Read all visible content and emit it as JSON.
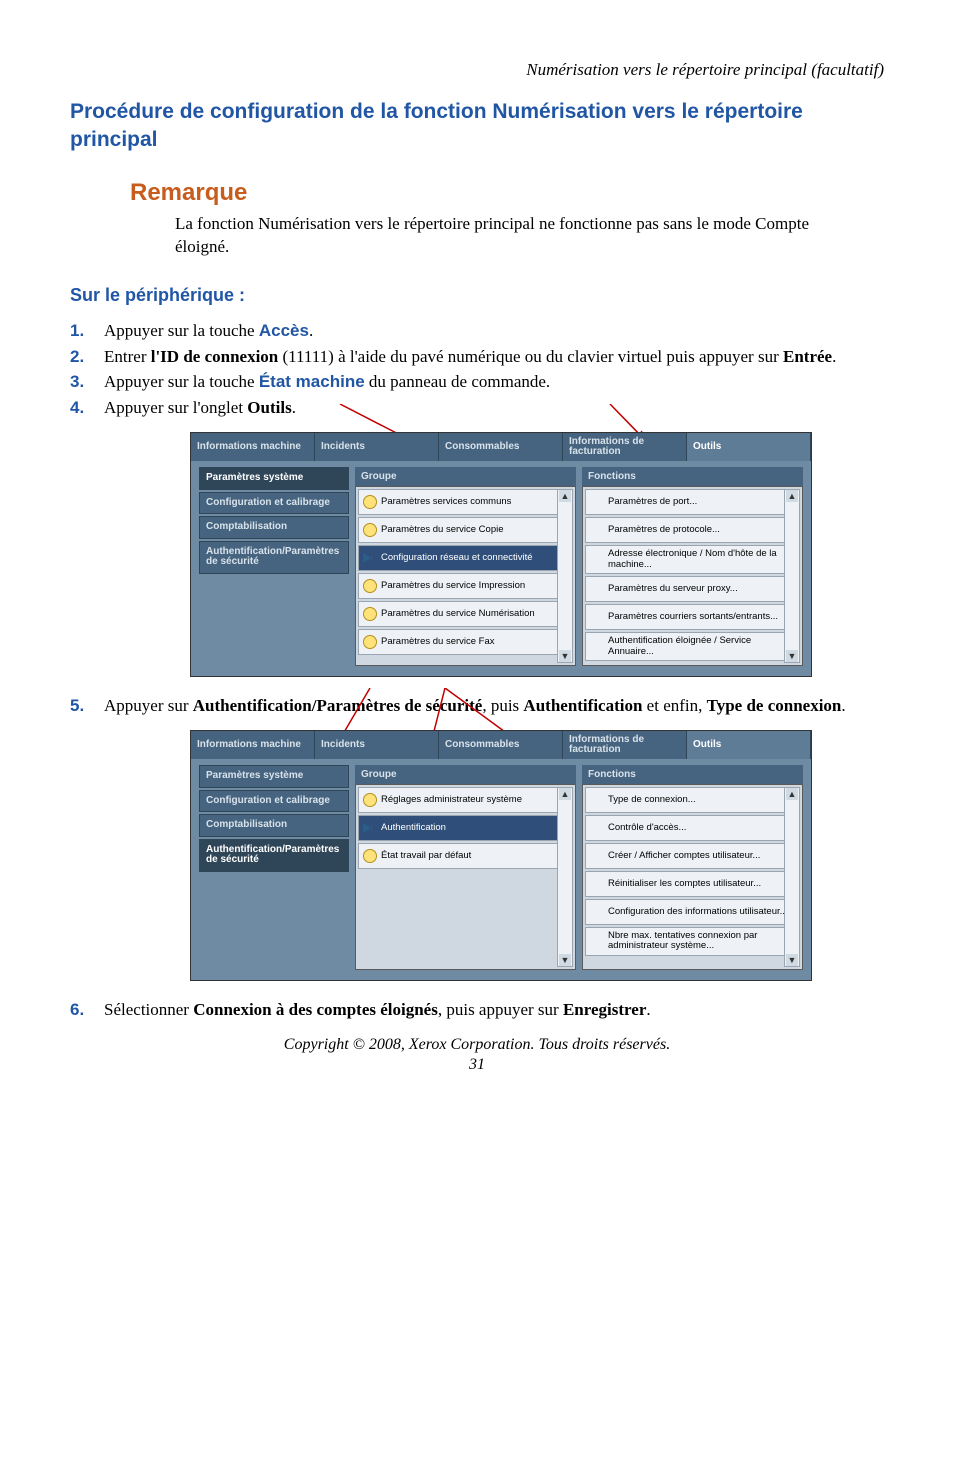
{
  "running_header": "Numérisation vers le répertoire principal (facultatif)",
  "title": "Procédure de configuration de la fonction Numérisation vers le répertoire principal",
  "remarque_heading": "Remarque",
  "remarque_body": "La fonction Numérisation vers le répertoire principal ne fonctionne pas sans le mode Compte éloigné.",
  "subhead": "Sur le périphérique :",
  "steps": {
    "s1": {
      "num": "1.",
      "pre": "Appuyer sur la touche ",
      "kw": "Accès",
      "post": "."
    },
    "s2": {
      "num": "2.",
      "pre1": "Entrer ",
      "b1": "l'ID de connexion",
      "mid": " (11111) à l'aide du pavé numérique ou du clavier virtuel puis appuyer sur ",
      "b2": "Entrée",
      "post": "."
    },
    "s3": {
      "num": "3.",
      "pre": "Appuyer sur la touche ",
      "kw": "État machine",
      "post": " du panneau de commande."
    },
    "s4": {
      "num": "4.",
      "pre": "Appuyer sur l'onglet ",
      "b1": "Outils",
      "post": "."
    },
    "s5": {
      "num": "5.",
      "pre": "Appuyer sur ",
      "b1": "Authentification/Paramètres de sécurité",
      "mid1": ", puis ",
      "b2": "Authentification",
      "mid2": " et enfin, ",
      "b3": "Type de connexion",
      "post": "."
    },
    "s6": {
      "num": "6.",
      "pre": "Sélectionner ",
      "b1": "Connexion à des comptes éloignés",
      "mid": ", puis appuyer sur ",
      "b2": "Enregistrer",
      "post": "."
    }
  },
  "screenshot1": {
    "tabs": [
      "Informations machine",
      "Incidents",
      "Consommables",
      "Informations de facturation",
      "Outils"
    ],
    "side": [
      "Paramètres système",
      "Configuration et calibrage",
      "Comptabilisation",
      "Authentification/Paramètres de sécurité"
    ],
    "side_selected_index": 0,
    "col1_head": "Groupe",
    "col1": [
      "Paramètres services communs",
      "Paramètres du service Copie",
      "Configuration réseau et connectivité",
      "Paramètres du service Impression",
      "Paramètres du service Numérisation",
      "Paramètres du service Fax"
    ],
    "col1_selected_index": 2,
    "col2_head": "Fonctions",
    "col2": [
      "Paramètres de port...",
      "Paramètres de protocole...",
      "Adresse électronique / Nom d'hôte de la machine...",
      "Paramètres du serveur proxy...",
      "Paramètres courriers sortants/entrants...",
      "Authentification éloignée / Service Annuaire..."
    ]
  },
  "screenshot2": {
    "tabs": [
      "Informations machine",
      "Incidents",
      "Consommables",
      "Informations de facturation",
      "Outils"
    ],
    "side": [
      "Paramètres système",
      "Configuration et calibrage",
      "Comptabilisation",
      "Authentification/Paramètres de sécurité"
    ],
    "side_selected_index": 3,
    "col1_head": "Groupe",
    "col1": [
      "Réglages administrateur système",
      "Authentification",
      "État travail par défaut"
    ],
    "col1_selected_index": 1,
    "col2_head": "Fonctions",
    "col2": [
      "Type de connexion...",
      "Contrôle d'accès...",
      "Créer / Afficher comptes utilisateur...",
      "Réinitialiser les comptes utilisateur...",
      "Configuration des informations utilisateur...",
      "Nbre max. tentatives connexion par administrateur système..."
    ]
  },
  "copyright": "Copyright © 2008, Xerox Corporation. Tous droits réservés.",
  "pagenum": "31"
}
